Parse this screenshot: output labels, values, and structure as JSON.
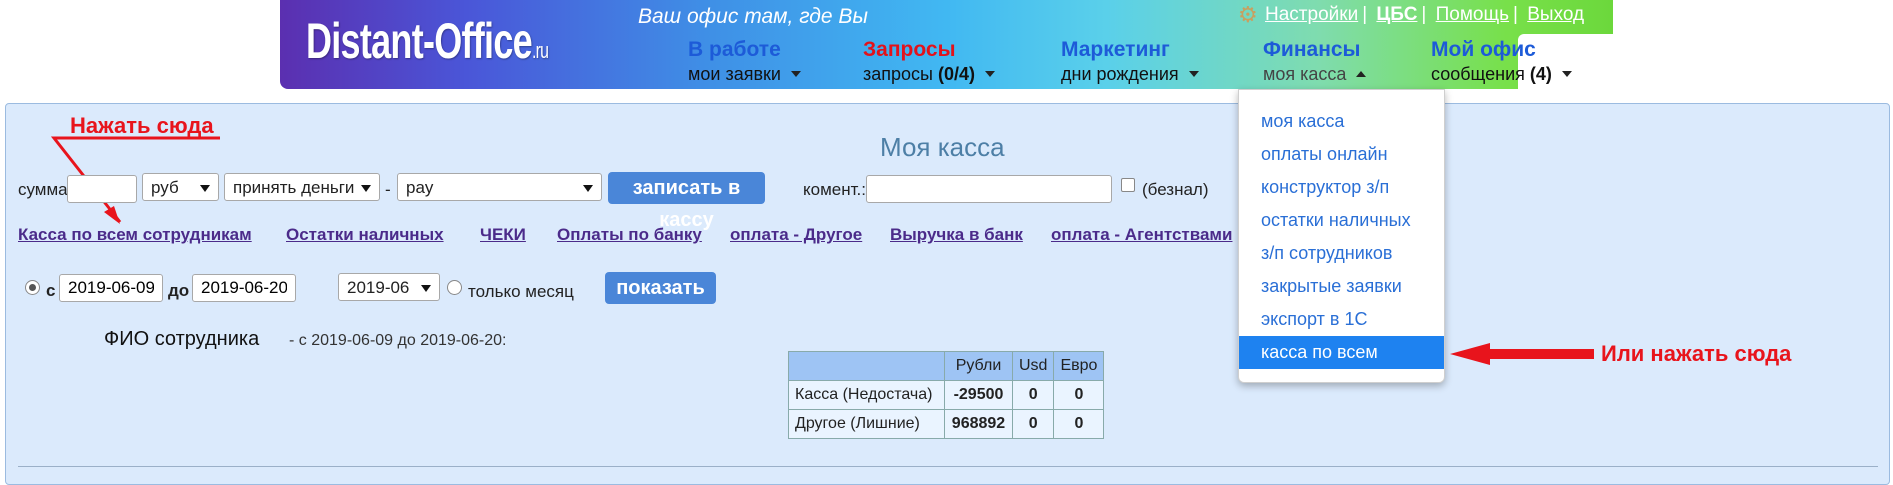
{
  "header": {
    "logo_main": "Distant-Office",
    "logo_tld": ".ru",
    "slogan": "Ваш офис там, где Вы",
    "links": {
      "settings": "Настройки",
      "cbs": "ЦБС",
      "help": "Помощь",
      "logout": "Выход",
      "sep": "|"
    },
    "nav": [
      {
        "title": "В работе",
        "sub": "мои заявки",
        "count": ""
      },
      {
        "title": "Запросы",
        "sub": "запросы",
        "count": "(0/4)"
      },
      {
        "title": "Маркетинг",
        "sub": "дни рождения",
        "count": ""
      },
      {
        "title": "Финансы",
        "sub": "моя касса",
        "count": ""
      },
      {
        "title": "Мой офис",
        "sub": "сообщения",
        "count": "(4)"
      }
    ],
    "colors": {
      "requests_title": "#e3121b",
      "nav_title": "#1d5bd8"
    }
  },
  "page_title": "Моя касса",
  "annotations": {
    "click_here": "Нажать сюда",
    "or_click_here": "Или нажать сюда"
  },
  "form": {
    "amount_label": "сумма",
    "amount_value": "",
    "currency": "руб",
    "operation": "принять деньги",
    "dash": "-",
    "pay_type": "pay",
    "submit": "записать в кассу",
    "comment_label": "комент.:",
    "comment_value": "",
    "cashless_label": "(безнал)"
  },
  "links": [
    "Касса по всем сотрудникам",
    "Остатки наличных",
    "ЧЕКИ",
    "Оплаты по банку",
    "оплата - Другое",
    "Выручка в банк",
    "оплата - Агентствами"
  ],
  "filter": {
    "from_label": "с",
    "from": "2019-06-09",
    "to_label": "до",
    "to": "2019-06-20",
    "month": "2019-06",
    "month_only_label": "только месяц",
    "show_button": "показать"
  },
  "employee_label": "ФИО сотрудника",
  "period_text": "- с 2019-06-09 до 2019-06-20:",
  "table": {
    "headers": [
      "",
      "Рубли",
      "Usd",
      "Евро"
    ],
    "rows": [
      [
        "Касса (Недостача)",
        "-29500",
        "0",
        "0"
      ],
      [
        "Другое (Лишние)",
        "968892",
        "0",
        "0"
      ]
    ]
  },
  "dropdown": {
    "items": [
      "моя касса",
      "оплаты онлайн",
      "конструктор з/п",
      "остатки наличных",
      "з/п сотрудников",
      "закрытые заявки",
      "экспорт в 1С",
      "касса по всем"
    ],
    "active_index": 7
  }
}
